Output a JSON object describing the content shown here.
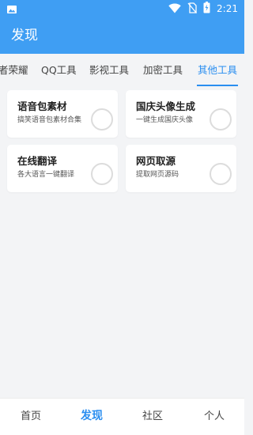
{
  "status_bar": {
    "time": "2:21",
    "icons": [
      "image-icon",
      "wifi-icon",
      "no-sim-icon",
      "battery-charging-icon"
    ]
  },
  "app_bar": {
    "title": "发现"
  },
  "tabs": {
    "items": [
      {
        "label": "者荣耀",
        "active": false
      },
      {
        "label": "QQ工具",
        "active": false
      },
      {
        "label": "影视工具",
        "active": false
      },
      {
        "label": "加密工具",
        "active": false
      },
      {
        "label": "其他工具",
        "active": true
      }
    ]
  },
  "cards": [
    {
      "title": "语音包素材",
      "desc": "搞笑语音包素材合集"
    },
    {
      "title": "国庆头像生成",
      "desc": "一键生成国庆头像"
    },
    {
      "title": "在线翻译",
      "desc": "各大语言一键翻译"
    },
    {
      "title": "网页取源",
      "desc": "提取网页源码"
    }
  ],
  "bottom_nav": {
    "items": [
      {
        "label": "首页",
        "active": false
      },
      {
        "label": "发现",
        "active": true
      },
      {
        "label": "社区",
        "active": false
      },
      {
        "label": "个人",
        "active": false
      }
    ]
  },
  "colors": {
    "primary": "#3f9ef3",
    "accent": "#2a8ef0",
    "background": "#f3f4f6",
    "card": "#ffffff"
  }
}
